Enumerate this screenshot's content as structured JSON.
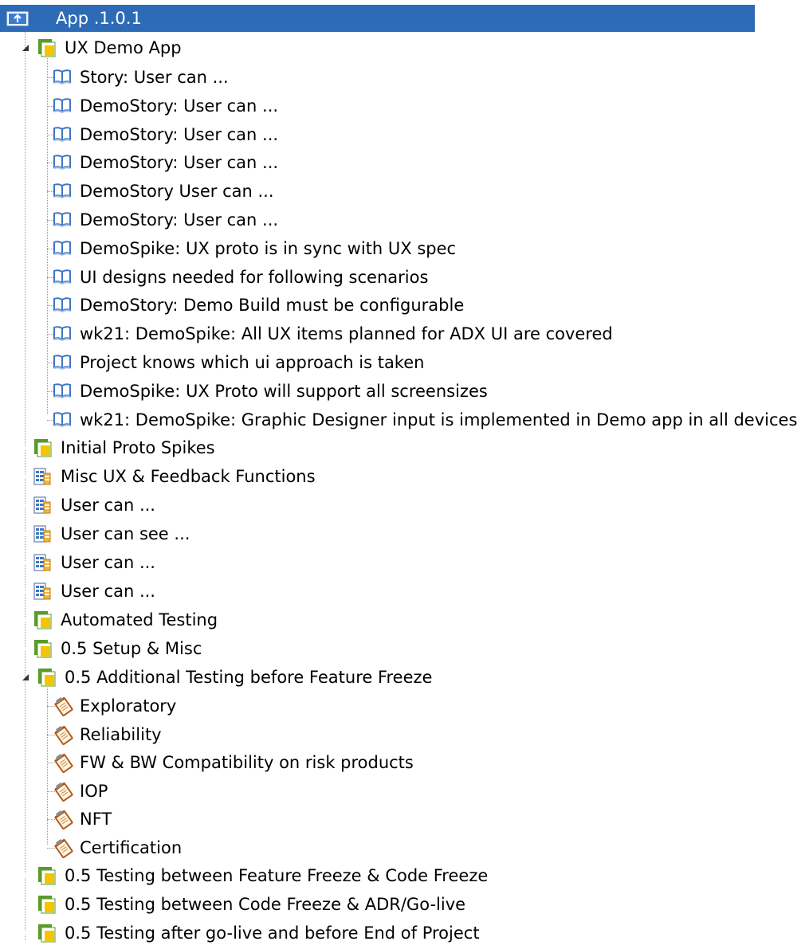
{
  "root": {
    "label": "App .1.0.1",
    "highlight_color": "#2d6bb7"
  },
  "ux_demo": {
    "label": "UX Demo App",
    "children": [
      {
        "label": "Story:  User can ..."
      },
      {
        "label": "DemoStory:  User can ..."
      },
      {
        "label": "DemoStory:  User can ..."
      },
      {
        "label": "DemoStory:  User can ..."
      },
      {
        "label": "DemoStory   User can ..."
      },
      {
        "label": "DemoStory:  User can ..."
      },
      {
        "label": "DemoSpike: UX proto is in sync with UX spec"
      },
      {
        "label": "UI designs needed for following scenarios"
      },
      {
        "label": "DemoStory: Demo Build must be configurable"
      },
      {
        "label": "wk21: DemoSpike: All UX items planned for ADX UI are covered"
      },
      {
        "label": "Project knows which ui approach is taken"
      },
      {
        "label": "DemoSpike: UX Proto will support all  screensizes"
      },
      {
        "label": "wk21: DemoSpike: Graphic Designer input is implemented in Demo app in all devices"
      }
    ]
  },
  "groups_a": [
    {
      "label": "Initial Proto Spikes",
      "icon": "feature-folder-icon"
    },
    {
      "label": "Misc UX & Feedback Functions",
      "icon": "backlog-icon"
    },
    {
      "label": "User can ...",
      "icon": "backlog-icon"
    },
    {
      "label": "User can see ...",
      "icon": "backlog-icon"
    },
    {
      "label": "User can ...",
      "icon": "backlog-icon"
    },
    {
      "label": "User can ...",
      "icon": "backlog-icon"
    },
    {
      "label": "Automated Testing",
      "icon": "feature-folder-icon"
    },
    {
      "label": "0.5 Setup & Misc",
      "icon": "feature-folder-icon"
    }
  ],
  "testing": {
    "label": "0.5 Additional Testing before Feature Freeze",
    "children": [
      {
        "label": "Exploratory"
      },
      {
        "label": "Reliability"
      },
      {
        "label": "FW & BW Compatibility on risk products"
      },
      {
        "label": "IOP"
      },
      {
        "label": "NFT"
      },
      {
        "label": "Certification"
      }
    ]
  },
  "groups_b": [
    {
      "label": "0.5 Testing between Feature Freeze & Code Freeze"
    },
    {
      "label": "0.5 Testing between Code Freeze & ADR/Go-live"
    },
    {
      "label": "0.5 Testing after go-live and before End of Project"
    }
  ]
}
